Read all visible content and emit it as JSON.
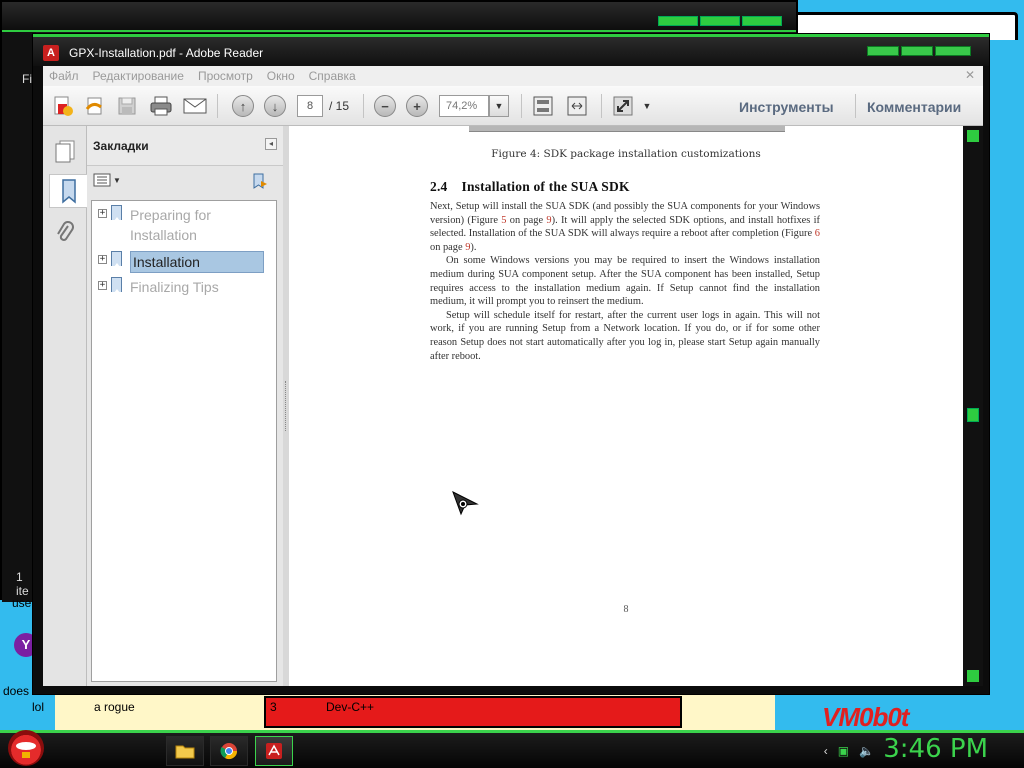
{
  "window": {
    "title": "GPX-Installation.pdf - Adobe Reader"
  },
  "menu": [
    "Файл",
    "Редактирование",
    "Просмотр",
    "Окно",
    "Справка"
  ],
  "toolbar": {
    "page_current": "8",
    "page_total": "/ 15",
    "zoom": "74,2%",
    "tools_label": "Инструменты",
    "comments_label": "Комментарии"
  },
  "bookmarks": {
    "title": "Закладки",
    "items": [
      {
        "label": "Preparing for Installation",
        "selected": false
      },
      {
        "label": "Installation",
        "selected": true
      },
      {
        "label": "Finalizing Tips",
        "selected": false
      }
    ]
  },
  "document": {
    "caption": "Figure 4: SDK package installation customizations",
    "section_number": "2.4",
    "section_title": "Installation of the SUA SDK",
    "para1_a": "Next, Setup will install the SUA SDK (and possibly the SUA components for your Windows version) (Figure ",
    "para1_l1": "5",
    "para1_b": " on page ",
    "para1_l2": "9",
    "para1_c": "). It will apply the selected SDK options, and install hotfixes if selected. Installation of the SUA SDK will always require a reboot after completion (Figure ",
    "para1_l3": "6",
    "para1_d": " on page ",
    "para1_l4": "9",
    "para1_e": ").",
    "para2": "On some Windows versions you may be required to insert the Windows installation medium during SUA component setup. After the SUA component has been installed, Setup requires access to the installation medium again. If Setup cannot find the installation medium, it will prompt you to reinsert the medium.",
    "para3": "Setup will schedule itself for restart, after the current user logs in again. This will not work, if you are running Setup from a Network location. If you do, or if for some other reason Setup does not start automatically after you log in, please start Setup again manually after reboot.",
    "page_number": "8"
  },
  "desktop": {
    "texts": [
      "lol",
      "a rogue",
      "3",
      "Dev-C++",
      "does",
      "use",
      "1 ite",
      "Fi"
    ],
    "watermark": "VM0b0t"
  },
  "taskbar": {
    "clock": "3:46 PM"
  },
  "colors": {
    "accent_green": "#3bd34c",
    "selection": "#a9c7e2",
    "link_red": "#c0392b"
  }
}
